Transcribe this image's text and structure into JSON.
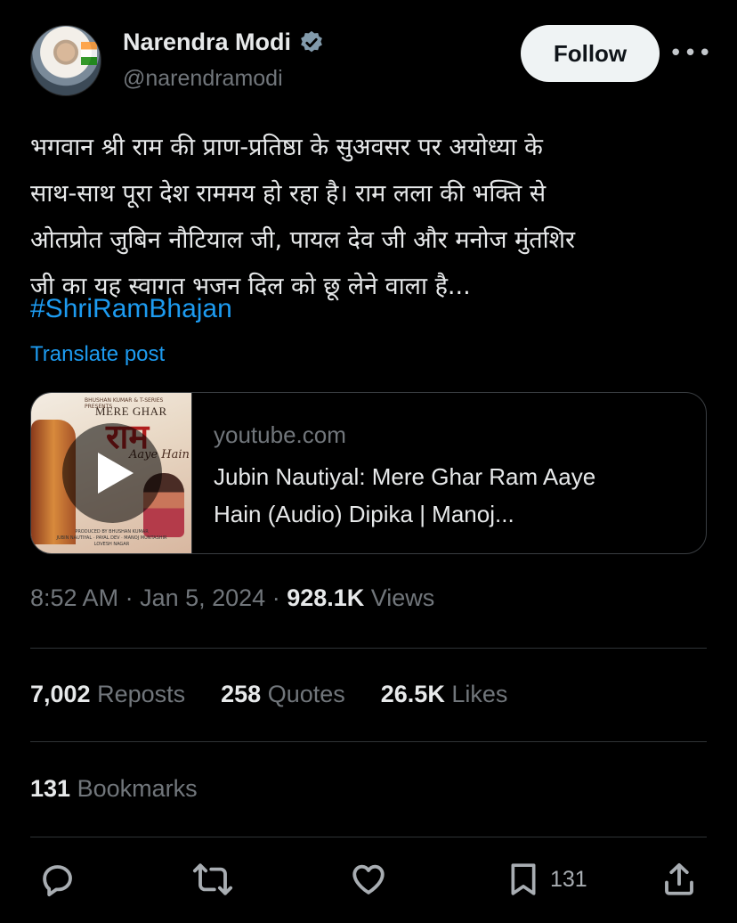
{
  "author": {
    "name": "Narendra Modi",
    "handle": "@narendramodi",
    "verified_icon": "verified-badge-icon",
    "avatar_icon": "avatar"
  },
  "actions_top": {
    "follow_label": "Follow",
    "more_label": "•••"
  },
  "post": {
    "text_lines": [
      "भगवान श्री राम की प्राण-प्रतिष्ठा के सुअवसर पर अयोध्या के",
      "साथ-साथ पूरा देश राममय हो रहा है। राम लला की भक्ति से",
      "ओतप्रोत जुबिन नौटियाल जी, पायल देव जी और मनोज मुंतशिर",
      "जी का यह स्वागत भजन दिल को छू लेने वाला है..."
    ],
    "hashtag": "#ShriRamBhajan",
    "translate_label": "Translate post"
  },
  "link_card": {
    "domain": "youtube.com",
    "title_line1": "Jubin Nautiyal: Mere Ghar Ram Aaye",
    "title_line2": "Hain (Audio) Dipika | Manoj...",
    "thumbnail": {
      "top_text": "BHUSHAN KUMAR & T-SERIES PRESENTS",
      "title_top": "MERE GHAR",
      "title_main": "राम",
      "title_bottom": "Aaye Hain",
      "credits_line1": "PRODUCED BY BHUSHAN KUMAR",
      "credits_line2": "JUBIN NAUTIYAL · PAYAL DEV · MANOJ MUNTASHIR",
      "credits_line3": "LOVESH NAGAR"
    }
  },
  "meta": {
    "time": "8:52 AM",
    "sep1": " · ",
    "date": "Jan 5, 2024",
    "sep2": " · ",
    "views_count": "928.1K",
    "views_label": " Views"
  },
  "stats": {
    "reposts_count": "7,002",
    "reposts_label": " Reposts",
    "quotes_count": "258",
    "quotes_label": " Quotes",
    "likes_count": "26.5K",
    "likes_label": " Likes",
    "bookmarks_count": "131",
    "bookmarks_label": " Bookmarks"
  },
  "action_bar": {
    "reply_icon": "reply-icon",
    "repost_icon": "repost-icon",
    "like_icon": "like-icon",
    "bookmark_icon": "bookmark-icon",
    "bookmark_count": "131",
    "share_icon": "share-icon"
  },
  "colors": {
    "background": "#000000",
    "text": "#e7e9ea",
    "muted": "#71767b",
    "link": "#1d9bf0",
    "divider": "#2f3336",
    "follow_bg": "#eff3f4"
  }
}
